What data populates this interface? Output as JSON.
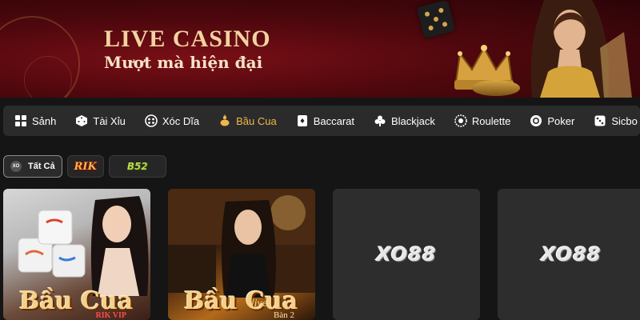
{
  "banner": {
    "title": "LIVE CASINO",
    "subtitle": "Mượt mà hiện đại"
  },
  "nav": {
    "items": [
      {
        "label": "Sảnh",
        "icon": "grid-icon"
      },
      {
        "label": "Tài Xỉu",
        "icon": "dice-icon"
      },
      {
        "label": "Xóc Dĩa",
        "icon": "coin-plate-icon"
      },
      {
        "label": "Bầu Cua",
        "icon": "gourd-icon",
        "active": true
      },
      {
        "label": "Baccarat",
        "icon": "playing-card-icon"
      },
      {
        "label": "Blackjack",
        "icon": "club-suit-icon"
      },
      {
        "label": "Roulette",
        "icon": "roulette-wheel-icon"
      },
      {
        "label": "Poker",
        "icon": "poker-chip-icon"
      },
      {
        "label": "Sicbo",
        "icon": "sicbo-dice-icon"
      }
    ],
    "active_color": "#f0b84a"
  },
  "filters": {
    "all": {
      "label": "Tất Cả",
      "badge": "XO"
    },
    "rik": {
      "label": "RIK"
    },
    "b52": {
      "label": "B52"
    }
  },
  "games": [
    {
      "title": "Bầu Cua",
      "sub": "RIK VIP"
    },
    {
      "title": "Bầu Cua",
      "sub": "Bàn 2",
      "sub2": "live"
    },
    {
      "logo": "XO88"
    },
    {
      "logo": "XO88"
    }
  ]
}
